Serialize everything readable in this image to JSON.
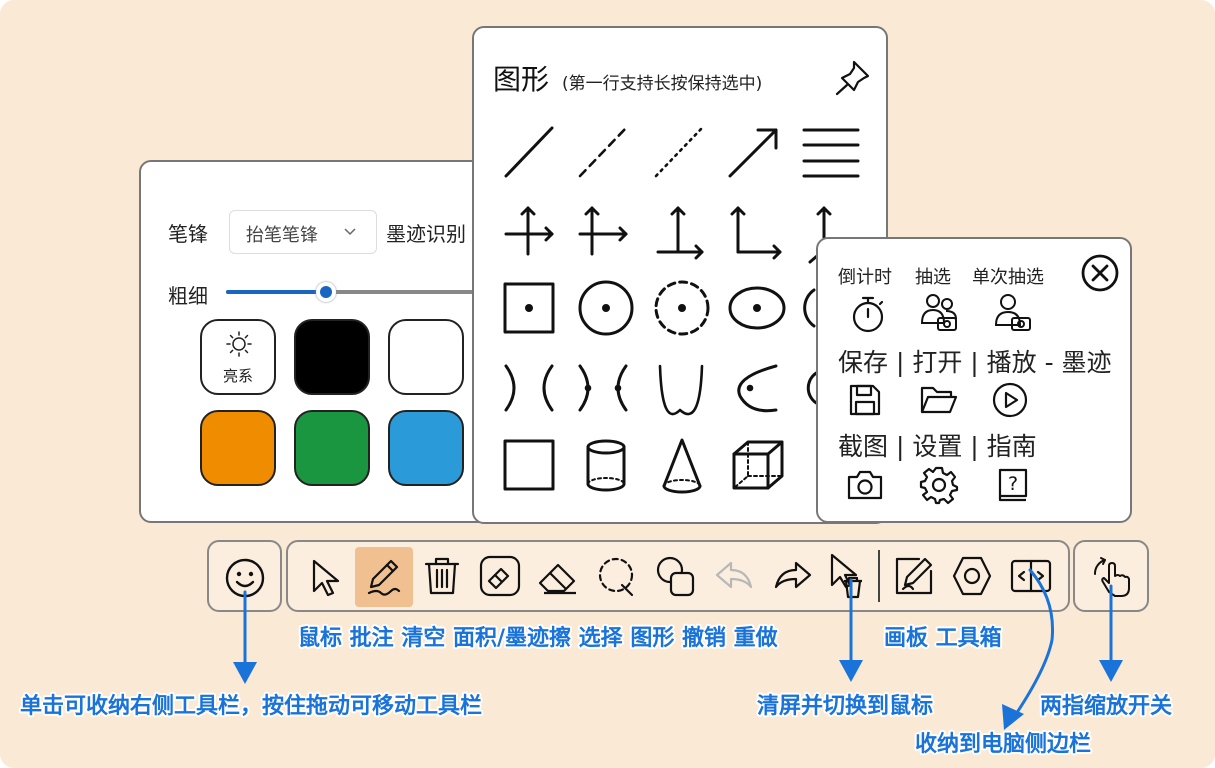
{
  "pen_panel": {
    "tip_label": "笔锋",
    "tip_select_value": "抬笔笔锋",
    "ink_recognition_label": "墨迹识别",
    "thickness_label": "粗细",
    "thickness_fraction": 0.4,
    "theme_label": "亮系",
    "colors": [
      "#000000",
      "#ffffff",
      "#f08c00",
      "#1a9641",
      "#2b9ad8"
    ]
  },
  "shape_panel": {
    "title": "图形",
    "subtitle": "(第一行支持长按保持选中)"
  },
  "toolbox_panel": {
    "row1_labels": [
      "倒计时",
      "抽选",
      "单次抽选"
    ],
    "row2_label": "保存 | 打开 | 播放 - 墨迹",
    "row3_label": "截图 | 设置 | 指南"
  },
  "captions": {
    "tools": "鼠标 批注 清空 面积/墨迹擦 选择 图形 撤销 重做",
    "board_toolbox": "画板 工具箱",
    "collapse_toolbar": "单击可收纳右侧工具栏，按住拖动可移动工具栏",
    "clear_and_mouse": "清屏并切换到鼠标",
    "two_finger": "两指缩放开关",
    "collapse_sidebar": "收纳到电脑侧边栏"
  },
  "colors": {
    "accent": "#1a73d9",
    "active_tool": "#f0c090",
    "background": "#fae9d4"
  }
}
